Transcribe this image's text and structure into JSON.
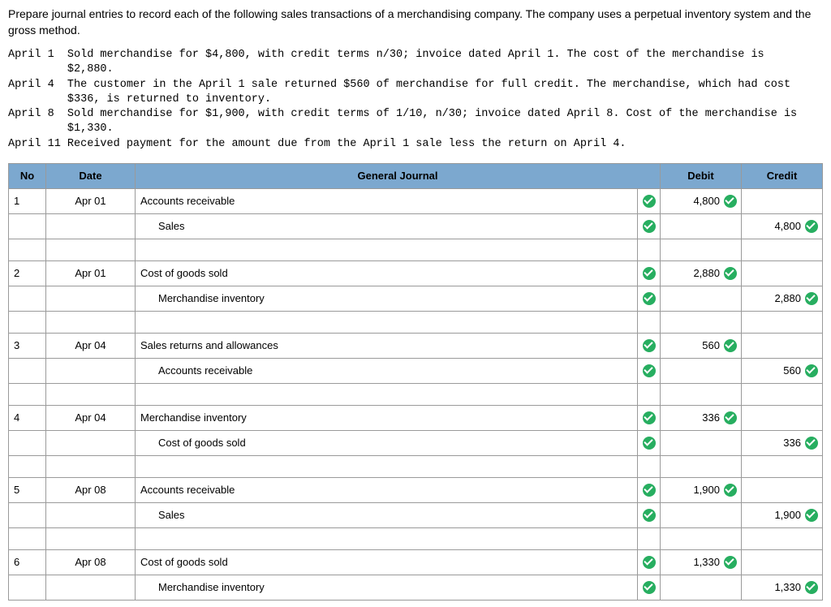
{
  "intro": "Prepare journal entries to record each of the following sales transactions of a merchandising company. The company uses a perpetual inventory system and the gross method.",
  "transactions": "April 1  Sold merchandise for $4,800, with credit terms n/30; invoice dated April 1. The cost of the merchandise is\n         $2,880.\nApril 4  The customer in the April 1 sale returned $560 of merchandise for full credit. The merchandise, which had cost\n         $336, is returned to inventory.\nApril 8  Sold merchandise for $1,900, with credit terms of 1/10, n/30; invoice dated April 8. Cost of the merchandise is\n         $1,330.\nApril 11 Received payment for the amount due from the April 1 sale less the return on April 4.",
  "headers": {
    "no": "No",
    "date": "Date",
    "gj": "General Journal",
    "debit": "Debit",
    "credit": "Credit"
  },
  "rows": [
    {
      "no": "1",
      "date": "Apr 01",
      "acct": "Accounts receivable",
      "indent": false,
      "ck": true,
      "debit": "4,800",
      "credit": ""
    },
    {
      "no": "",
      "date": "",
      "acct": "Sales",
      "indent": true,
      "ck": true,
      "debit": "",
      "credit": "4,800"
    },
    {
      "spacer": true
    },
    {
      "no": "2",
      "date": "Apr 01",
      "acct": "Cost of goods sold",
      "indent": false,
      "ck": true,
      "debit": "2,880",
      "credit": ""
    },
    {
      "no": "",
      "date": "",
      "acct": "Merchandise inventory",
      "indent": true,
      "ck": true,
      "debit": "",
      "credit": "2,880"
    },
    {
      "spacer": true
    },
    {
      "no": "3",
      "date": "Apr 04",
      "acct": "Sales returns and allowances",
      "indent": false,
      "ck": true,
      "debit": "560",
      "credit": ""
    },
    {
      "no": "",
      "date": "",
      "acct": "Accounts receivable",
      "indent": true,
      "ck": true,
      "debit": "",
      "credit": "560"
    },
    {
      "spacer": true
    },
    {
      "no": "4",
      "date": "Apr 04",
      "acct": "Merchandise inventory",
      "indent": false,
      "ck": true,
      "debit": "336",
      "credit": ""
    },
    {
      "no": "",
      "date": "",
      "acct": "Cost of goods sold",
      "indent": true,
      "ck": true,
      "debit": "",
      "credit": "336"
    },
    {
      "spacer": true
    },
    {
      "no": "5",
      "date": "Apr 08",
      "acct": "Accounts receivable",
      "indent": false,
      "ck": true,
      "debit": "1,900",
      "credit": ""
    },
    {
      "no": "",
      "date": "",
      "acct": "Sales",
      "indent": true,
      "ck": true,
      "debit": "",
      "credit": "1,900"
    },
    {
      "spacer": true
    },
    {
      "no": "6",
      "date": "Apr 08",
      "acct": "Cost of goods sold",
      "indent": false,
      "ck": true,
      "debit": "1,330",
      "credit": ""
    },
    {
      "no": "",
      "date": "",
      "acct": "Merchandise inventory",
      "indent": true,
      "ck": true,
      "debit": "",
      "credit": "1,330"
    }
  ]
}
